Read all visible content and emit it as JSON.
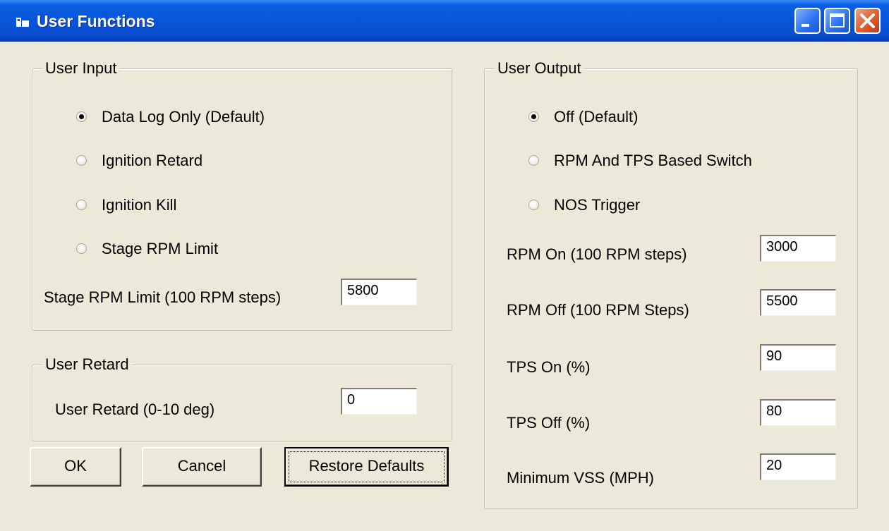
{
  "window": {
    "title": "User Functions",
    "buttons": {
      "minimize": "minimize",
      "maximize": "maximize",
      "close": "close"
    }
  },
  "user_input": {
    "legend": "User Input",
    "options": [
      {
        "label": "Data Log Only (Default)",
        "checked": true
      },
      {
        "label": "Ignition Retard",
        "checked": false
      },
      {
        "label": "Ignition Kill",
        "checked": false
      },
      {
        "label": "Stage RPM Limit",
        "checked": false
      }
    ],
    "stage_rpm_label": "Stage RPM Limit (100 RPM steps)",
    "stage_rpm_value": "5800"
  },
  "user_retard": {
    "legend": "User Retard",
    "label": "User Retard (0-10 deg)",
    "value": "0"
  },
  "user_output": {
    "legend": "User Output",
    "options": [
      {
        "label": "Off (Default)",
        "checked": true
      },
      {
        "label": "RPM And TPS Based Switch",
        "checked": false
      },
      {
        "label": "NOS Trigger",
        "checked": false
      }
    ],
    "fields": [
      {
        "label": "RPM On (100 RPM steps)",
        "value": "3000"
      },
      {
        "label": "RPM Off (100 RPM Steps)",
        "value": "5500"
      },
      {
        "label": "TPS On (%)",
        "value": "90"
      },
      {
        "label": "TPS Off (%)",
        "value": "80"
      },
      {
        "label": "Minimum VSS (MPH)",
        "value": "20"
      }
    ]
  },
  "actions": {
    "ok": "OK",
    "cancel": "Cancel",
    "restore": "Restore Defaults"
  },
  "colors": {
    "dialog_bg": "#ECE9D8",
    "titlebar": "#0754D9",
    "close_button": "#E15C2E"
  }
}
